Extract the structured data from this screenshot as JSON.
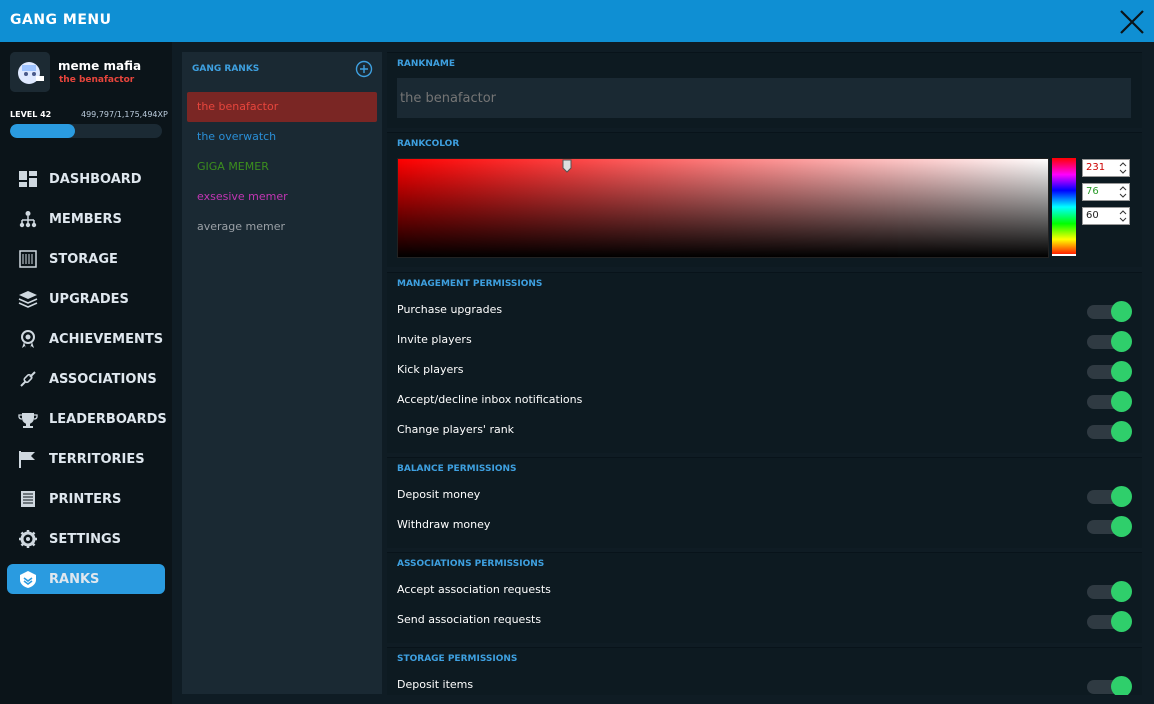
{
  "window": {
    "title": "GANG MENU"
  },
  "profile": {
    "gang_name": "meme mafia",
    "rank": "the benafactor",
    "level": "LEVEL 42",
    "xp_text": "499,797/1,175,494XP",
    "xp_fraction": 0.425
  },
  "nav": [
    {
      "label": "DASHBOARD",
      "icon": "dashboard-icon"
    },
    {
      "label": "MEMBERS",
      "icon": "members-icon"
    },
    {
      "label": "STORAGE",
      "icon": "storage-icon"
    },
    {
      "label": "UPGRADES",
      "icon": "upgrades-icon"
    },
    {
      "label": "ACHIEVEMENTS",
      "icon": "achievements-icon"
    },
    {
      "label": "ASSOCIATIONS",
      "icon": "associations-icon"
    },
    {
      "label": "LEADERBOARDS",
      "icon": "leaderboards-icon"
    },
    {
      "label": "TERRITORIES",
      "icon": "flag-icon"
    },
    {
      "label": "PRINTERS",
      "icon": "printer-icon"
    },
    {
      "label": "SETTINGS",
      "icon": "gear-icon"
    },
    {
      "label": "RANKS",
      "icon": "ranks-icon",
      "active": true
    }
  ],
  "ranks": {
    "title": "GANG RANKS",
    "items": [
      {
        "label": "the benafactor",
        "color": "#e7453c",
        "selected": true
      },
      {
        "label": "the overwatch",
        "color": "#2a8fd6"
      },
      {
        "label": "GIGA MEMER",
        "color": "#3c8f1e"
      },
      {
        "label": "exsesive memer",
        "color": "#c236b4"
      },
      {
        "label": "average memer",
        "color": "#9aa0a6"
      }
    ]
  },
  "rankname": {
    "title": "RANKNAME",
    "placeholder": "the benafactor"
  },
  "rankcolor": {
    "title": "RANKCOLOR",
    "r": "231",
    "g": "76",
    "b": "60"
  },
  "management": {
    "title": "MANAGEMENT PERMISSIONS",
    "items": [
      "Purchase upgrades",
      "Invite players",
      "Kick players",
      "Accept/decline inbox notifications",
      "Change players' rank"
    ]
  },
  "balance": {
    "title": "BALANCE PERMISSIONS",
    "items": [
      "Deposit money",
      "Withdraw money"
    ]
  },
  "associations": {
    "title": "ASSOCIATIONS PERMISSIONS",
    "items": [
      "Accept association requests",
      "Send association requests"
    ]
  },
  "storage": {
    "title": "STORAGE PERMISSIONS",
    "items": [
      "Deposit items"
    ]
  },
  "colors": {
    "accent": "#2a9be0",
    "titlebar": "#0f8fd3",
    "toggle_on": "#2fcf6b"
  }
}
